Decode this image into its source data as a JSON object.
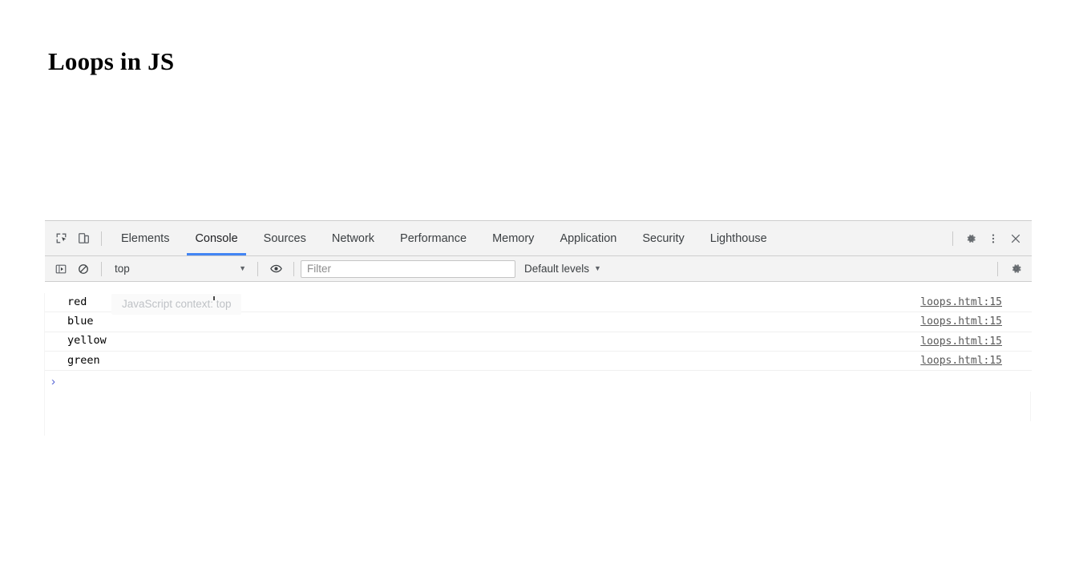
{
  "page": {
    "heading": "Loops in JS"
  },
  "devtools": {
    "tabbar": {
      "inspect_icon": "inspect-element-icon",
      "device_toolbar_icon": "device-toolbar-icon",
      "tabs": [
        {
          "label": "Elements",
          "active": false
        },
        {
          "label": "Console",
          "active": true
        },
        {
          "label": "Sources",
          "active": false
        },
        {
          "label": "Network",
          "active": false
        },
        {
          "label": "Performance",
          "active": false
        },
        {
          "label": "Memory",
          "active": false
        },
        {
          "label": "Application",
          "active": false
        },
        {
          "label": "Security",
          "active": false
        },
        {
          "label": "Lighthouse",
          "active": false
        }
      ],
      "settings_icon": "gear-icon",
      "more_icon": "kebab-menu-icon",
      "close_icon": "close-icon"
    },
    "console_toolbar": {
      "sidebar_toggle_icon": "console-sidebar-toggle-icon",
      "clear_icon": "clear-console-icon",
      "context": "top",
      "context_caret": "▼",
      "eye_icon": "eye-icon",
      "filter_value": "",
      "filter_placeholder": "Filter",
      "levels_label": "Default levels",
      "levels_caret": "▼",
      "settings_icon": "gear-icon"
    },
    "console_messages": [
      {
        "text": "red",
        "source": "loops.html:15"
      },
      {
        "text": "blue",
        "source": "loops.html:15"
      },
      {
        "text": "yellow",
        "source": "loops.html:15"
      },
      {
        "text": "green",
        "source": "loops.html:15"
      }
    ],
    "prompt": {
      "arrow": "›",
      "value": ""
    },
    "tooltip": {
      "text": "JavaScript context: top"
    },
    "colors": {
      "accent_blue": "#4285f4",
      "toolbar_bg": "#f3f3f3",
      "border": "#cdcdcd",
      "prompt_arrow": "#5564d6"
    }
  }
}
